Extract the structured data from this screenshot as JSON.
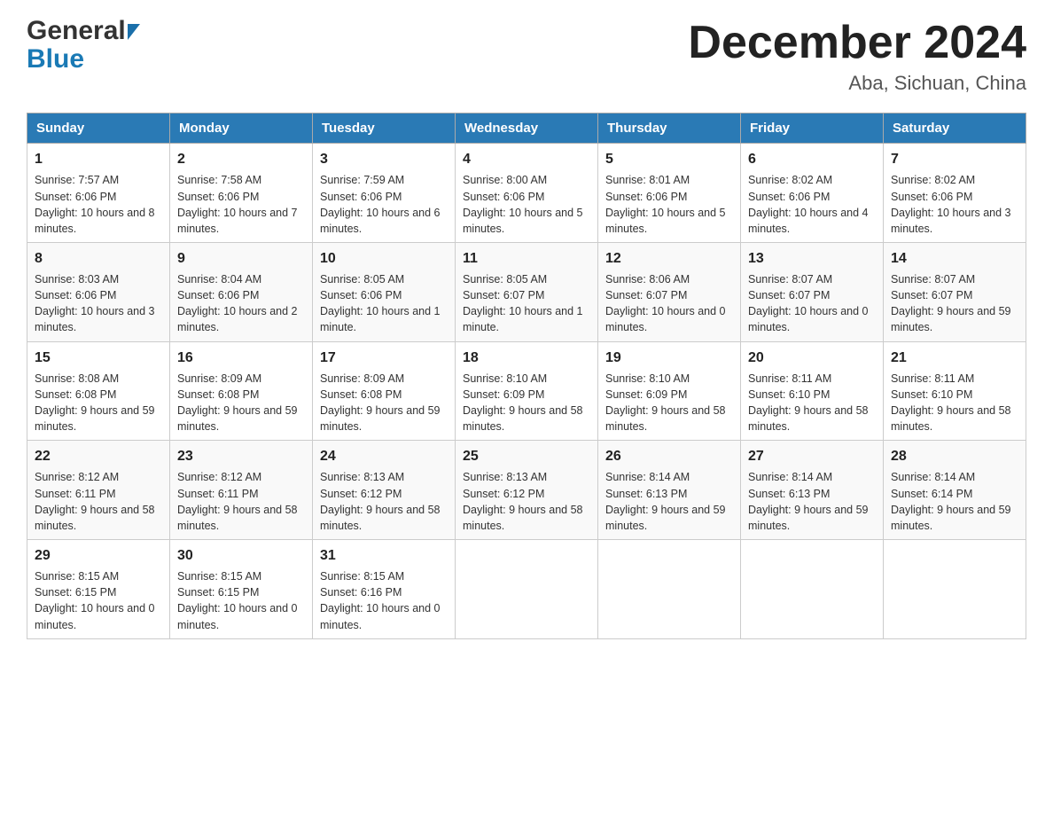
{
  "header": {
    "logo_general": "General",
    "logo_blue": "Blue",
    "title": "December 2024",
    "location": "Aba, Sichuan, China"
  },
  "days_of_week": [
    "Sunday",
    "Monday",
    "Tuesday",
    "Wednesday",
    "Thursday",
    "Friday",
    "Saturday"
  ],
  "weeks": [
    [
      {
        "day": "1",
        "sunrise": "7:57 AM",
        "sunset": "6:06 PM",
        "daylight": "10 hours and 8 minutes."
      },
      {
        "day": "2",
        "sunrise": "7:58 AM",
        "sunset": "6:06 PM",
        "daylight": "10 hours and 7 minutes."
      },
      {
        "day": "3",
        "sunrise": "7:59 AM",
        "sunset": "6:06 PM",
        "daylight": "10 hours and 6 minutes."
      },
      {
        "day": "4",
        "sunrise": "8:00 AM",
        "sunset": "6:06 PM",
        "daylight": "10 hours and 5 minutes."
      },
      {
        "day": "5",
        "sunrise": "8:01 AM",
        "sunset": "6:06 PM",
        "daylight": "10 hours and 5 minutes."
      },
      {
        "day": "6",
        "sunrise": "8:02 AM",
        "sunset": "6:06 PM",
        "daylight": "10 hours and 4 minutes."
      },
      {
        "day": "7",
        "sunrise": "8:02 AM",
        "sunset": "6:06 PM",
        "daylight": "10 hours and 3 minutes."
      }
    ],
    [
      {
        "day": "8",
        "sunrise": "8:03 AM",
        "sunset": "6:06 PM",
        "daylight": "10 hours and 3 minutes."
      },
      {
        "day": "9",
        "sunrise": "8:04 AM",
        "sunset": "6:06 PM",
        "daylight": "10 hours and 2 minutes."
      },
      {
        "day": "10",
        "sunrise": "8:05 AM",
        "sunset": "6:06 PM",
        "daylight": "10 hours and 1 minute."
      },
      {
        "day": "11",
        "sunrise": "8:05 AM",
        "sunset": "6:07 PM",
        "daylight": "10 hours and 1 minute."
      },
      {
        "day": "12",
        "sunrise": "8:06 AM",
        "sunset": "6:07 PM",
        "daylight": "10 hours and 0 minutes."
      },
      {
        "day": "13",
        "sunrise": "8:07 AM",
        "sunset": "6:07 PM",
        "daylight": "10 hours and 0 minutes."
      },
      {
        "day": "14",
        "sunrise": "8:07 AM",
        "sunset": "6:07 PM",
        "daylight": "9 hours and 59 minutes."
      }
    ],
    [
      {
        "day": "15",
        "sunrise": "8:08 AM",
        "sunset": "6:08 PM",
        "daylight": "9 hours and 59 minutes."
      },
      {
        "day": "16",
        "sunrise": "8:09 AM",
        "sunset": "6:08 PM",
        "daylight": "9 hours and 59 minutes."
      },
      {
        "day": "17",
        "sunrise": "8:09 AM",
        "sunset": "6:08 PM",
        "daylight": "9 hours and 59 minutes."
      },
      {
        "day": "18",
        "sunrise": "8:10 AM",
        "sunset": "6:09 PM",
        "daylight": "9 hours and 58 minutes."
      },
      {
        "day": "19",
        "sunrise": "8:10 AM",
        "sunset": "6:09 PM",
        "daylight": "9 hours and 58 minutes."
      },
      {
        "day": "20",
        "sunrise": "8:11 AM",
        "sunset": "6:10 PM",
        "daylight": "9 hours and 58 minutes."
      },
      {
        "day": "21",
        "sunrise": "8:11 AM",
        "sunset": "6:10 PM",
        "daylight": "9 hours and 58 minutes."
      }
    ],
    [
      {
        "day": "22",
        "sunrise": "8:12 AM",
        "sunset": "6:11 PM",
        "daylight": "9 hours and 58 minutes."
      },
      {
        "day": "23",
        "sunrise": "8:12 AM",
        "sunset": "6:11 PM",
        "daylight": "9 hours and 58 minutes."
      },
      {
        "day": "24",
        "sunrise": "8:13 AM",
        "sunset": "6:12 PM",
        "daylight": "9 hours and 58 minutes."
      },
      {
        "day": "25",
        "sunrise": "8:13 AM",
        "sunset": "6:12 PM",
        "daylight": "9 hours and 58 minutes."
      },
      {
        "day": "26",
        "sunrise": "8:14 AM",
        "sunset": "6:13 PM",
        "daylight": "9 hours and 59 minutes."
      },
      {
        "day": "27",
        "sunrise": "8:14 AM",
        "sunset": "6:13 PM",
        "daylight": "9 hours and 59 minutes."
      },
      {
        "day": "28",
        "sunrise": "8:14 AM",
        "sunset": "6:14 PM",
        "daylight": "9 hours and 59 minutes."
      }
    ],
    [
      {
        "day": "29",
        "sunrise": "8:15 AM",
        "sunset": "6:15 PM",
        "daylight": "10 hours and 0 minutes."
      },
      {
        "day": "30",
        "sunrise": "8:15 AM",
        "sunset": "6:15 PM",
        "daylight": "10 hours and 0 minutes."
      },
      {
        "day": "31",
        "sunrise": "8:15 AM",
        "sunset": "6:16 PM",
        "daylight": "10 hours and 0 minutes."
      },
      null,
      null,
      null,
      null
    ]
  ],
  "labels": {
    "sunrise": "Sunrise:",
    "sunset": "Sunset:",
    "daylight": "Daylight:"
  }
}
